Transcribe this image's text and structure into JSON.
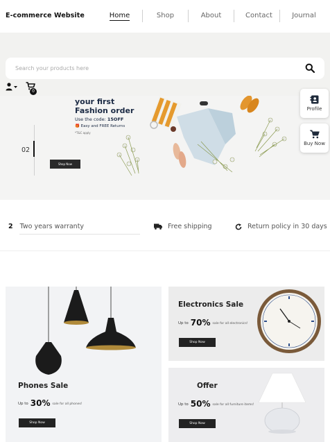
{
  "header": {
    "brand": "E-commerce Website",
    "nav": [
      "Home",
      "Shop",
      "About",
      "Contact",
      "Journal"
    ]
  },
  "search": {
    "placeholder": "Search your products here"
  },
  "cart": {
    "count": "0"
  },
  "hero": {
    "slide_number": "02",
    "title_line1": "your first",
    "title_line2": "Fashion order",
    "code_prefix": "Use the code:",
    "code": "15OFF",
    "returns": "Easy and FREE Returns",
    "tc": "*T&C apply",
    "button": "Shop Now"
  },
  "side_buttons": {
    "profile": "Profile",
    "buy_now": "Buy Now"
  },
  "features": {
    "warranty_num": "2",
    "warranty": "Two years warranty",
    "shipping": "Free shipping",
    "returns": "Return policy in 30 days"
  },
  "tiles": {
    "phones": {
      "title": "Phones Sale",
      "up_to": "Up to",
      "percent": "30%",
      "desc": "sale for all phones!",
      "button": "Shop Now"
    },
    "electronics": {
      "title": "Electronics Sale",
      "up_to": "Up to",
      "percent": "70%",
      "desc": "sale for all electronics!",
      "button": "Shop Now"
    },
    "offer": {
      "title": "Offer",
      "up_to": "Up to",
      "percent": "50%",
      "desc": "sale for all furniture items!",
      "button": "Shop Now"
    }
  },
  "icons": [
    "user-icon",
    "cart-icon",
    "search-icon",
    "profile-icon",
    "cart-buy-icon",
    "truck-icon",
    "refresh-icon"
  ]
}
